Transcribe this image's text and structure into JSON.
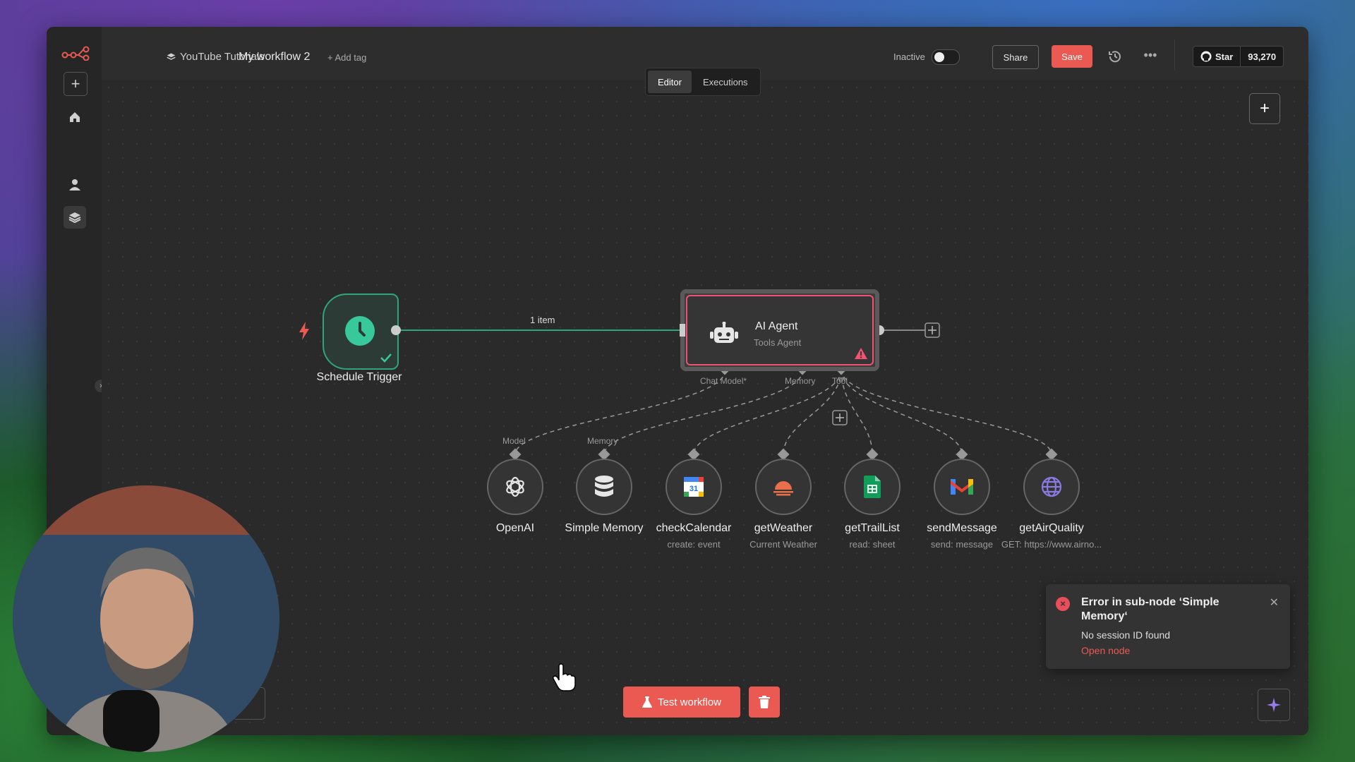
{
  "window": {
    "breadcrumb_project": "YouTube Tutorials",
    "workflow_name": "My workflow 2",
    "add_tag": "+ Add tag"
  },
  "header": {
    "status_label": "Inactive",
    "active": false,
    "share_label": "Share",
    "save_label": "Save",
    "github_star_label": "Star",
    "github_star_count": "93,270"
  },
  "tabs": [
    {
      "label": "Editor",
      "active": true
    },
    {
      "label": "Executions",
      "active": false
    }
  ],
  "canvas": {
    "trigger": {
      "label": "Schedule Trigger",
      "icon": "clock-icon"
    },
    "edge_label": "1 item",
    "agent": {
      "title": "AI Agent",
      "subtitle": "Tools Agent",
      "ports": [
        "Chat Model*",
        "Memory",
        "Tool"
      ]
    },
    "tools": [
      {
        "label": "OpenAI",
        "sub": "",
        "port": "Model",
        "icon": "openai-icon"
      },
      {
        "label": "Simple Memory",
        "sub": "",
        "port": "Memory",
        "icon": "database-icon"
      },
      {
        "label": "checkCalendar",
        "sub": "create: event",
        "port": "",
        "icon": "google-calendar-icon"
      },
      {
        "label": "getWeather",
        "sub": "Current Weather",
        "port": "",
        "icon": "weather-icon"
      },
      {
        "label": "getTrailList",
        "sub": "read: sheet",
        "port": "",
        "icon": "google-sheets-icon"
      },
      {
        "label": "sendMessage",
        "sub": "send: message",
        "port": "",
        "icon": "gmail-icon"
      },
      {
        "label": "getAirQuality",
        "sub": "GET: https://www.airno...",
        "port": "",
        "icon": "globe-icon"
      }
    ]
  },
  "toast": {
    "title": "Error in sub-node ‘Simple Memory‘",
    "message": "No session ID found",
    "link": "Open node"
  },
  "footer": {
    "test_label": "Test workflow"
  },
  "colors": {
    "accent": "#ea5a52",
    "trigger": "#37c99a",
    "error_border": "#f0536f"
  }
}
